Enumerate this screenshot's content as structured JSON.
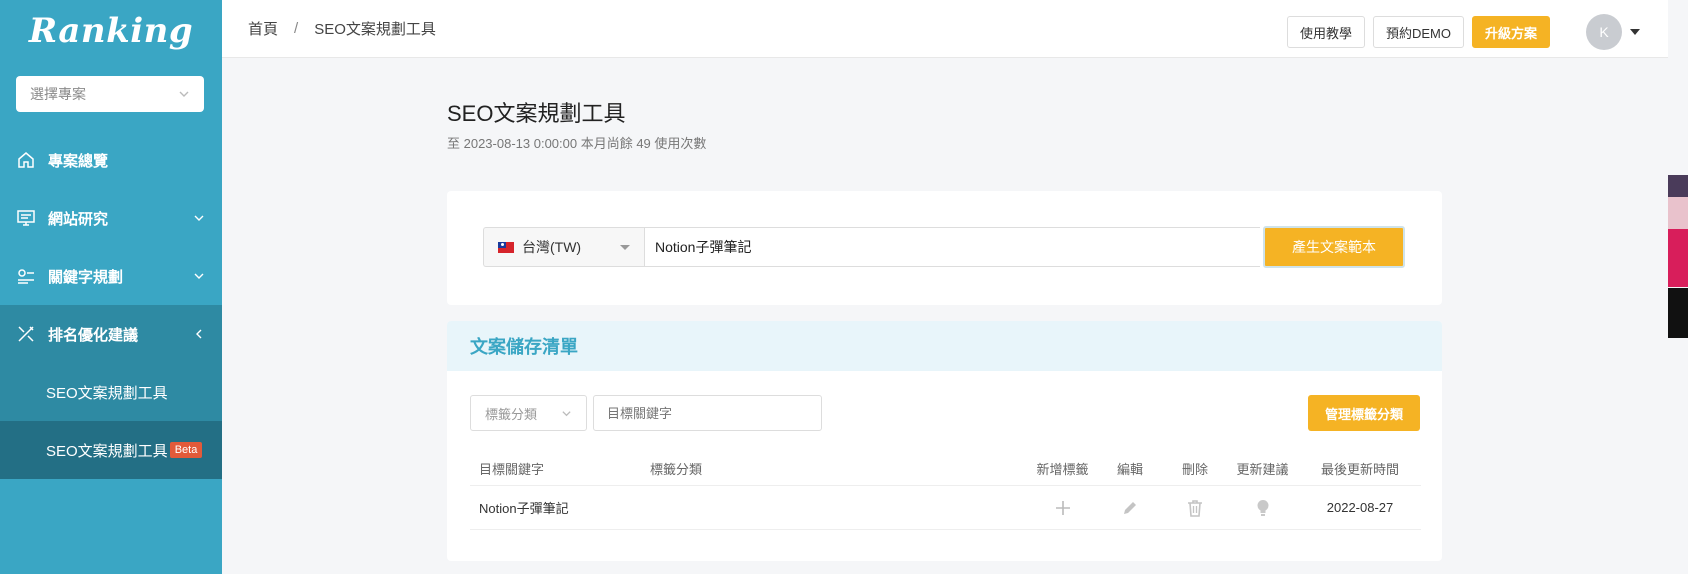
{
  "sidebar": {
    "logo": "Ranking",
    "project_select_placeholder": "選擇專案",
    "items": [
      {
        "label": "專案總覽",
        "icon": "home-icon"
      },
      {
        "label": "網站研究",
        "icon": "monitor-icon"
      },
      {
        "label": "關鍵字規劃",
        "icon": "keyword-icon"
      },
      {
        "label": "排名優化建議",
        "icon": "tools-icon"
      }
    ],
    "subitems": [
      {
        "label": "SEO文案規劃工具"
      },
      {
        "label": "SEO文案規劃工具",
        "badge": "Beta"
      }
    ]
  },
  "topbar": {
    "breadcrumb": [
      "首頁",
      "SEO文案規劃工具"
    ],
    "breadcrumb_sep": "/",
    "tutorial_label": "使用教學",
    "demo_label": "預約DEMO",
    "upgrade_label": "升級方案",
    "avatar_initial": "K"
  },
  "main": {
    "title": "SEO文案規劃工具",
    "subtitle": "至 2023-08-13 0:00:00 本月尚餘 49 使用次數",
    "country": "台灣(TW)",
    "keyword_value": "Notion子彈筆記",
    "generate_label": "產生文案範本"
  },
  "saved": {
    "title": "文案儲存清單",
    "tag_filter_placeholder": "標籤分類",
    "keyword_filter_placeholder": "目標關鍵字",
    "manage_label": "管理標籤分類",
    "columns": [
      "目標關鍵字",
      "標籤分類",
      "新增標籤",
      "編輯",
      "刪除",
      "更新建議",
      "最後更新時間"
    ],
    "rows": [
      {
        "keyword": "Notion子彈筆記",
        "tags": "",
        "updated": "2022-08-27"
      }
    ]
  },
  "colors": {
    "sidebar": "#3aa6c4",
    "accent": "#f5b324",
    "beta": "#e25a3a"
  }
}
